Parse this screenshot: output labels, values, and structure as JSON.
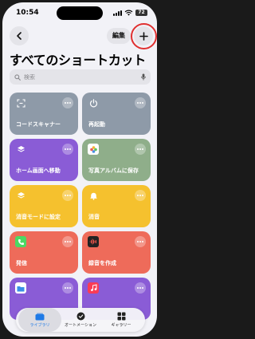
{
  "status_bar": {
    "time": "10:54",
    "battery": "72"
  },
  "nav": {
    "edit_label": "編集",
    "add_label": "+"
  },
  "title": "すべてのショートカット",
  "search": {
    "placeholder": "検索"
  },
  "shortcuts": [
    {
      "label": "コードスキャナー",
      "color": "#8e9aa8",
      "icon": "code-scanner-icon"
    },
    {
      "label": "再起動",
      "color": "#8e9aa8",
      "icon": "power-icon"
    },
    {
      "label": "ホーム画面へ移動",
      "color": "#8a5cd6",
      "icon": "layers-icon"
    },
    {
      "label": "写真アルバムに保存",
      "color": "#8fae8a",
      "icon": "photos-icon"
    },
    {
      "label": "消音モードに設定",
      "color": "#f5c12e",
      "icon": "layers-icon"
    },
    {
      "label": "消音",
      "color": "#f5c12e",
      "icon": "bell-icon"
    },
    {
      "label": "発信",
      "color": "#ee6b5a",
      "icon": "phone-icon"
    },
    {
      "label": "録音を作成",
      "color": "#ee6b5a",
      "icon": "voice-memo-icon"
    },
    {
      "label": "",
      "color": "#8a5cd6",
      "icon": "files-icon"
    },
    {
      "label": "",
      "color": "#8a5cd6",
      "icon": "music-icon"
    }
  ],
  "tabbar": {
    "tabs": [
      {
        "label": "ライブラリ",
        "icon": "library-icon",
        "active": true
      },
      {
        "label": "オートメーション",
        "icon": "automation-icon",
        "active": false
      },
      {
        "label": "ギャラリー",
        "icon": "gallery-icon",
        "active": false
      }
    ]
  },
  "colors": {
    "accent": "#1f7ae6",
    "highlight": "#e03030"
  }
}
